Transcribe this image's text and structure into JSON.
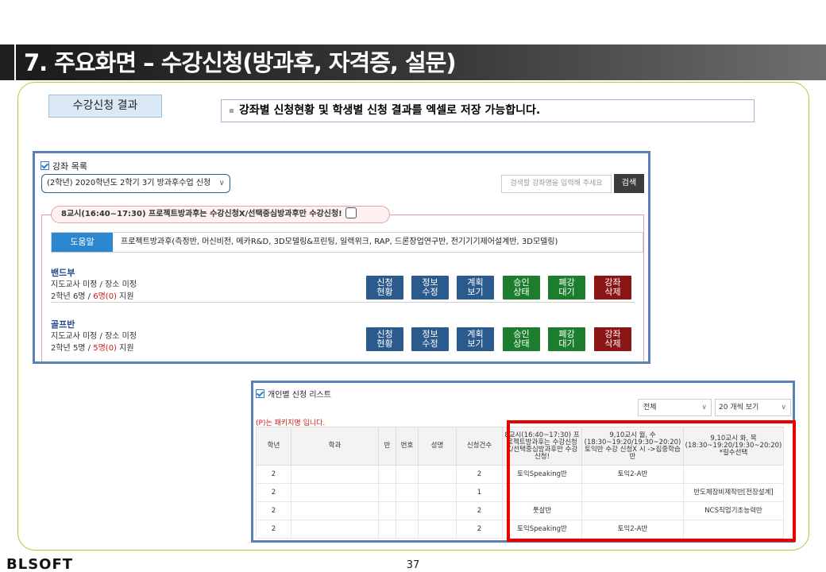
{
  "page": {
    "title": "7. 주요화면 – 수강신청(방과후, 자격증, 설문)",
    "section_tag": "수강신청 결과",
    "note": "강좌별 신청현황 및 학생별 신청 결과를 엑셀로 저장 가능합니다.",
    "page_number": "37",
    "logo": "BLSOFT"
  },
  "course_panel": {
    "title": "강좌 목록",
    "program_select": "(2학년) 2020학년도 2학기 3기 방과후수업 신청",
    "search_placeholder": "검색할 강좌명을 입력해 주세요",
    "search_button": "검색",
    "notice": "8교시(16:40~17:30) 프로젝트방과후는 수강신청X/선택중심방과후만 수강신청!",
    "help_label": "도움말",
    "help_text": "프로젝트방과후(측정반, 머신비전, 메카R&D, 3D모델링&프린팅, 일렉위크, RAP, 드론장업연구반, 전기기기제어설계반, 3D모델링)",
    "courses": [
      {
        "name": "밴드부",
        "line1": "지도교사 미정 / 장소 미정",
        "grade": "2학년 6명 / ",
        "applied": "6명(0)",
        "suffix": " 지원"
      },
      {
        "name": "골프반",
        "line1": "지도교사 미정 / 장소 미정",
        "grade": "2학년 5명 / ",
        "applied": "5명(0)",
        "suffix": " 지원"
      }
    ],
    "buttons": [
      "신청\n현황",
      "정보\n수정",
      "계획\n보기",
      "승인\n상태",
      "폐강\n대기",
      "강좌\n삭제"
    ],
    "colors": {
      "blue": "#2b5a8c",
      "green": "#1c7d2e",
      "red": "#8b1414",
      "help": "#2a87d0"
    }
  },
  "student_panel": {
    "title": "개인별 신청 리스트",
    "filter": "전체",
    "page_size": "20 개씩 보기",
    "note": "(P)는 패키지명 입니다.",
    "columns": [
      "학년",
      "학과",
      "반",
      "번호",
      "성명",
      "신청건수",
      "8교시(16:40~17:30) 프로젝트방과후는 수강신청X/선택중심방과후만 수강신청!",
      "9,10교시 월, 수 (18:30~19:20/19:30~20:20) 토익반 수강 신청X 시 ->집중학습반",
      "9,10교시 화, 목 (18:30~19:20/19:30~20:20) *필수선택"
    ],
    "rows": [
      [
        "2",
        "",
        "",
        "",
        "",
        "2",
        "토익Speaking반",
        "토익2-A반",
        ""
      ],
      [
        "2",
        "",
        "",
        "",
        "",
        "1",
        "",
        "",
        "반도체장비제작반[전장설계]"
      ],
      [
        "2",
        "",
        "",
        "",
        "",
        "2",
        "풋살반",
        "",
        "NCS직업기초능력반"
      ],
      [
        "2",
        "",
        "",
        "",
        "",
        "2",
        "토익Speaking반",
        "토익2-A반",
        ""
      ]
    ],
    "highlight_color": "#e60000"
  }
}
